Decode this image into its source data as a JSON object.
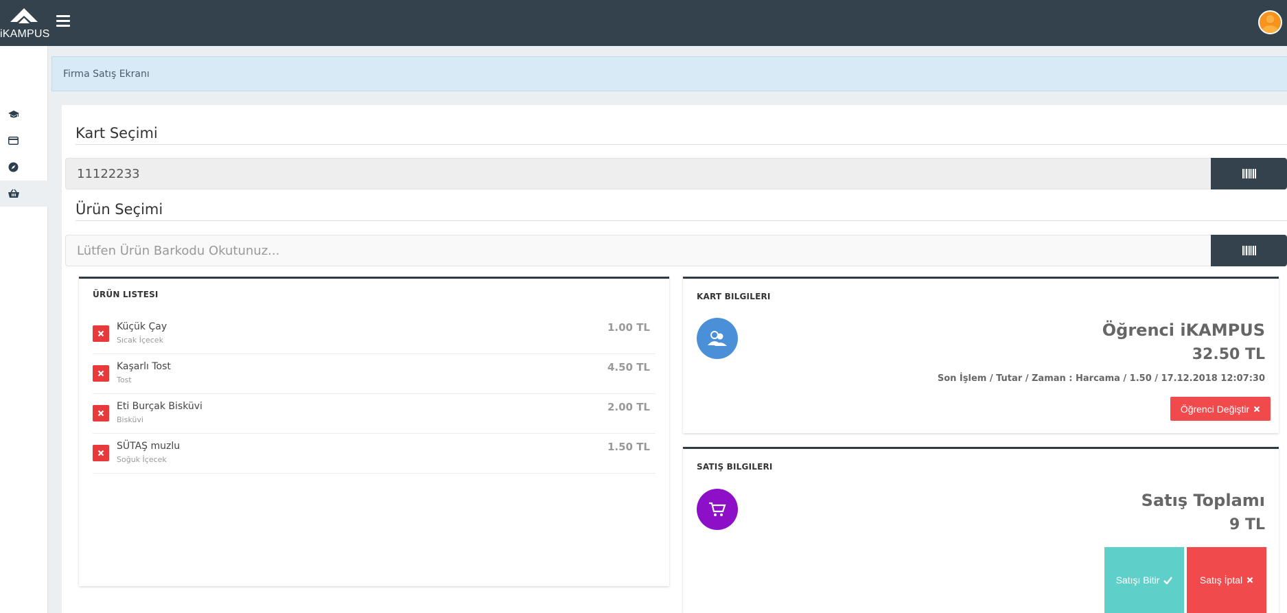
{
  "header": {
    "logo_text": "iKAMPUS",
    "menu_icon": "hamburger-icon",
    "avatar_icon": "user-avatar-icon"
  },
  "sidebar": {
    "items": [
      {
        "icon": "graduation-cap-icon",
        "active": false
      },
      {
        "icon": "credit-card-icon",
        "active": false
      },
      {
        "icon": "compass-icon",
        "active": false
      },
      {
        "icon": "shopping-basket-icon",
        "active": true
      }
    ]
  },
  "breadcrumb": {
    "text": "Firma Satış Ekranı"
  },
  "card_section": {
    "title": "Kart Seçimi",
    "value": "11122233",
    "button_icon": "barcode-icon"
  },
  "product_section": {
    "title": "Ürün Seçimi",
    "value": "",
    "placeholder": "Lütfen Ürün Barkodu Okutunuz...",
    "button_icon": "barcode-icon"
  },
  "product_list": {
    "title": "ÜRÜN LISTESI",
    "items": [
      {
        "name": "Küçük Çay",
        "category": "Sıcak İçecek",
        "price": "1.00 TL"
      },
      {
        "name": "Kaşarlı Tost",
        "category": "Tost",
        "price": "4.50 TL"
      },
      {
        "name": "Eti Burçak Bisküvi",
        "category": "Bisküvi",
        "price": "2.00 TL"
      },
      {
        "name": "SÜTAŞ muzlu",
        "category": "Soğuk İçecek",
        "price": "1.50 TL"
      }
    ]
  },
  "card_info": {
    "title": "KART BILGILERI",
    "icon": "users-icon",
    "icon_color": "#4a90d9",
    "owner": "Öğrenci iKAMPUS",
    "balance": "32.50 TL",
    "last_tx": "Son İşlem / Tutar / Zaman : Harcama / 1.50 / 17.12.2018 12:07:30",
    "change_button": "Öğrenci Değiştir"
  },
  "sale_info": {
    "title": "SATIŞ BILGILERI",
    "icon": "cart-icon",
    "icon_color": "#8e0fc8",
    "total_label": "Satış Toplamı",
    "total_value": "9 TL",
    "finish_button": "Satışı Bitir",
    "cancel_button": "Satış İptal"
  }
}
